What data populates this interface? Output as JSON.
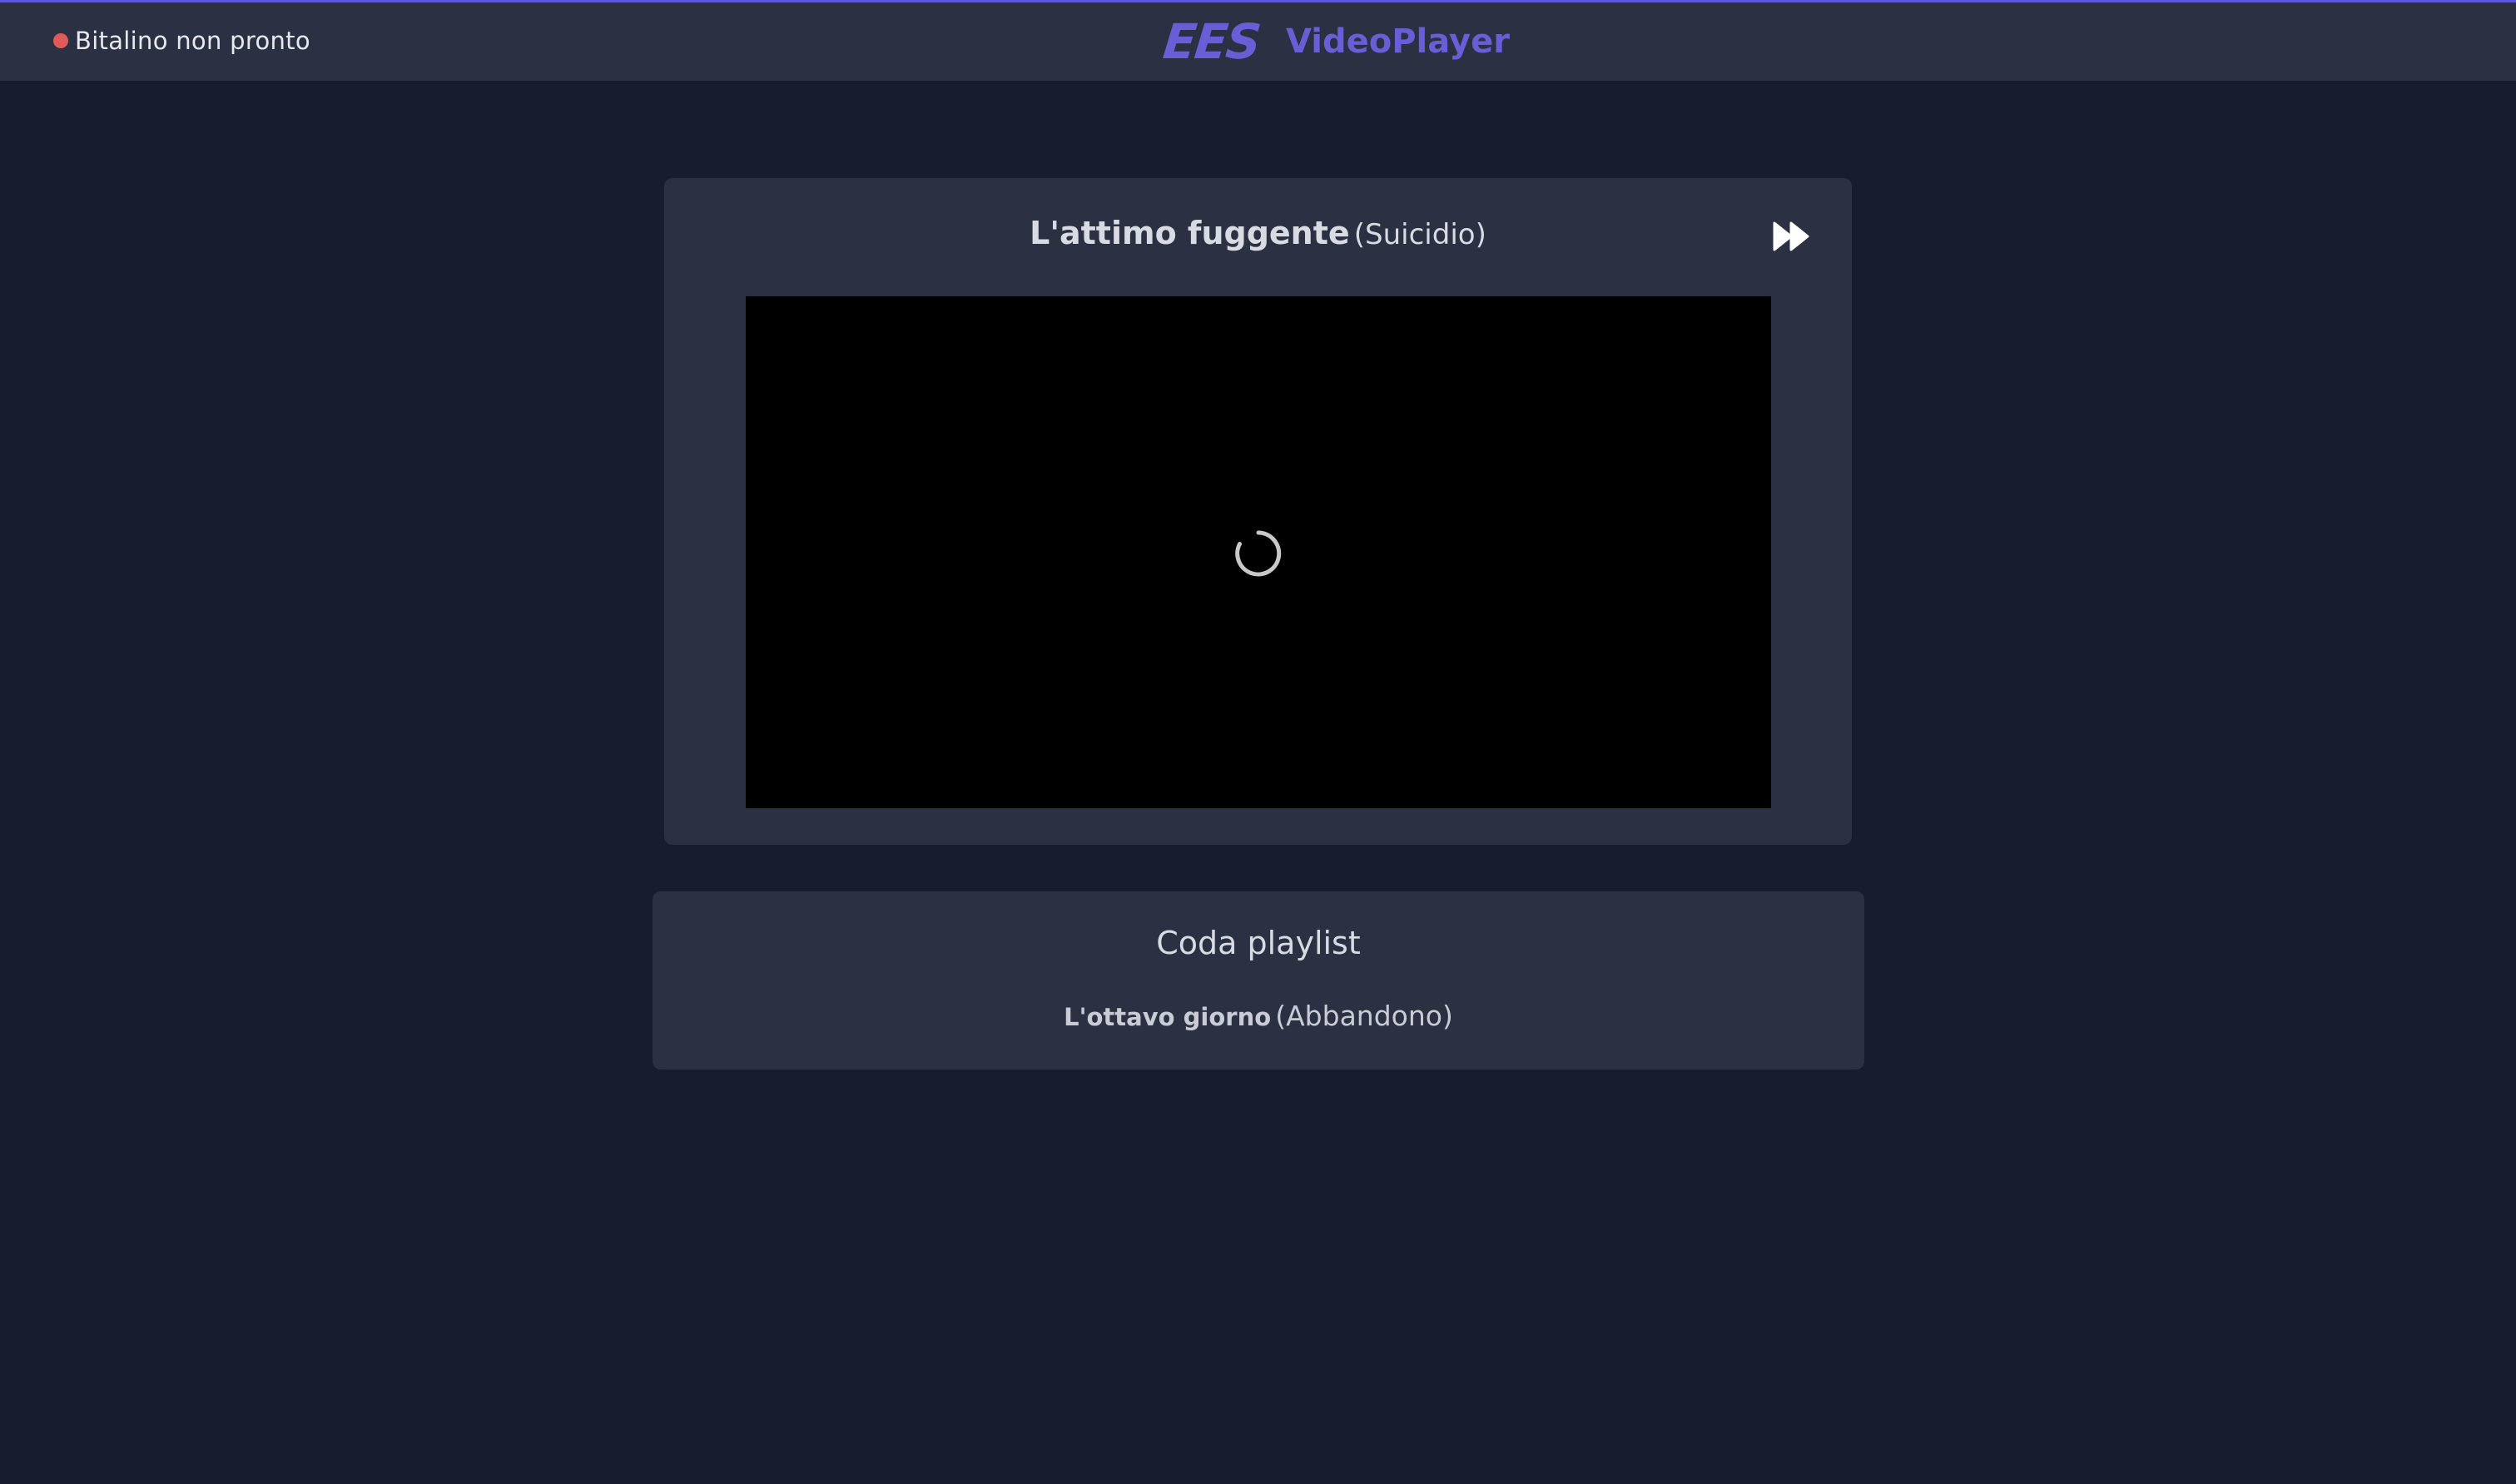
{
  "header": {
    "status": {
      "text": "Bitalino non pronto",
      "dot_color": "#e05a5a"
    },
    "brand": {
      "logo_text": "EES",
      "title": "VideoPlayer",
      "color": "#6a5ed6"
    }
  },
  "player": {
    "title": "L'attimo fuggente",
    "category": "(Suicidio)",
    "skip_icon": "fast-forward-icon",
    "loading_icon": "spinner-icon"
  },
  "playlist": {
    "heading": "Coda playlist",
    "items": [
      {
        "title": "L'ottavo giorno",
        "category": "(Abbandono)"
      }
    ]
  }
}
